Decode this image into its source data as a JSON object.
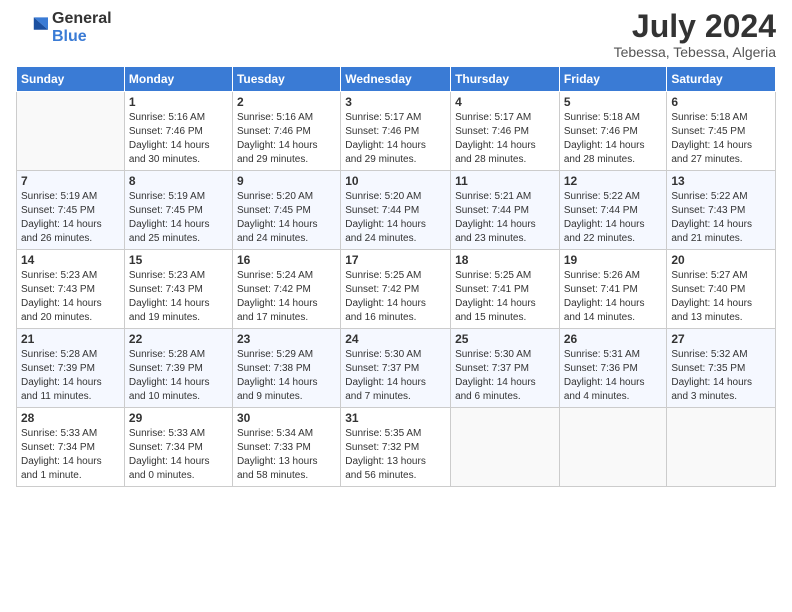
{
  "logo": {
    "general": "General",
    "blue": "Blue"
  },
  "title": {
    "month_year": "July 2024",
    "location": "Tebessa, Tebessa, Algeria"
  },
  "headers": [
    "Sunday",
    "Monday",
    "Tuesday",
    "Wednesday",
    "Thursday",
    "Friday",
    "Saturday"
  ],
  "weeks": [
    [
      {
        "day": "",
        "info": ""
      },
      {
        "day": "1",
        "info": "Sunrise: 5:16 AM\nSunset: 7:46 PM\nDaylight: 14 hours\nand 30 minutes."
      },
      {
        "day": "2",
        "info": "Sunrise: 5:16 AM\nSunset: 7:46 PM\nDaylight: 14 hours\nand 29 minutes."
      },
      {
        "day": "3",
        "info": "Sunrise: 5:17 AM\nSunset: 7:46 PM\nDaylight: 14 hours\nand 29 minutes."
      },
      {
        "day": "4",
        "info": "Sunrise: 5:17 AM\nSunset: 7:46 PM\nDaylight: 14 hours\nand 28 minutes."
      },
      {
        "day": "5",
        "info": "Sunrise: 5:18 AM\nSunset: 7:46 PM\nDaylight: 14 hours\nand 28 minutes."
      },
      {
        "day": "6",
        "info": "Sunrise: 5:18 AM\nSunset: 7:45 PM\nDaylight: 14 hours\nand 27 minutes."
      }
    ],
    [
      {
        "day": "7",
        "info": "Sunrise: 5:19 AM\nSunset: 7:45 PM\nDaylight: 14 hours\nand 26 minutes."
      },
      {
        "day": "8",
        "info": "Sunrise: 5:19 AM\nSunset: 7:45 PM\nDaylight: 14 hours\nand 25 minutes."
      },
      {
        "day": "9",
        "info": "Sunrise: 5:20 AM\nSunset: 7:45 PM\nDaylight: 14 hours\nand 24 minutes."
      },
      {
        "day": "10",
        "info": "Sunrise: 5:20 AM\nSunset: 7:44 PM\nDaylight: 14 hours\nand 24 minutes."
      },
      {
        "day": "11",
        "info": "Sunrise: 5:21 AM\nSunset: 7:44 PM\nDaylight: 14 hours\nand 23 minutes."
      },
      {
        "day": "12",
        "info": "Sunrise: 5:22 AM\nSunset: 7:44 PM\nDaylight: 14 hours\nand 22 minutes."
      },
      {
        "day": "13",
        "info": "Sunrise: 5:22 AM\nSunset: 7:43 PM\nDaylight: 14 hours\nand 21 minutes."
      }
    ],
    [
      {
        "day": "14",
        "info": "Sunrise: 5:23 AM\nSunset: 7:43 PM\nDaylight: 14 hours\nand 20 minutes."
      },
      {
        "day": "15",
        "info": "Sunrise: 5:23 AM\nSunset: 7:43 PM\nDaylight: 14 hours\nand 19 minutes."
      },
      {
        "day": "16",
        "info": "Sunrise: 5:24 AM\nSunset: 7:42 PM\nDaylight: 14 hours\nand 17 minutes."
      },
      {
        "day": "17",
        "info": "Sunrise: 5:25 AM\nSunset: 7:42 PM\nDaylight: 14 hours\nand 16 minutes."
      },
      {
        "day": "18",
        "info": "Sunrise: 5:25 AM\nSunset: 7:41 PM\nDaylight: 14 hours\nand 15 minutes."
      },
      {
        "day": "19",
        "info": "Sunrise: 5:26 AM\nSunset: 7:41 PM\nDaylight: 14 hours\nand 14 minutes."
      },
      {
        "day": "20",
        "info": "Sunrise: 5:27 AM\nSunset: 7:40 PM\nDaylight: 14 hours\nand 13 minutes."
      }
    ],
    [
      {
        "day": "21",
        "info": "Sunrise: 5:28 AM\nSunset: 7:39 PM\nDaylight: 14 hours\nand 11 minutes."
      },
      {
        "day": "22",
        "info": "Sunrise: 5:28 AM\nSunset: 7:39 PM\nDaylight: 14 hours\nand 10 minutes."
      },
      {
        "day": "23",
        "info": "Sunrise: 5:29 AM\nSunset: 7:38 PM\nDaylight: 14 hours\nand 9 minutes."
      },
      {
        "day": "24",
        "info": "Sunrise: 5:30 AM\nSunset: 7:37 PM\nDaylight: 14 hours\nand 7 minutes."
      },
      {
        "day": "25",
        "info": "Sunrise: 5:30 AM\nSunset: 7:37 PM\nDaylight: 14 hours\nand 6 minutes."
      },
      {
        "day": "26",
        "info": "Sunrise: 5:31 AM\nSunset: 7:36 PM\nDaylight: 14 hours\nand 4 minutes."
      },
      {
        "day": "27",
        "info": "Sunrise: 5:32 AM\nSunset: 7:35 PM\nDaylight: 14 hours\nand 3 minutes."
      }
    ],
    [
      {
        "day": "28",
        "info": "Sunrise: 5:33 AM\nSunset: 7:34 PM\nDaylight: 14 hours\nand 1 minute."
      },
      {
        "day": "29",
        "info": "Sunrise: 5:33 AM\nSunset: 7:34 PM\nDaylight: 14 hours\nand 0 minutes."
      },
      {
        "day": "30",
        "info": "Sunrise: 5:34 AM\nSunset: 7:33 PM\nDaylight: 13 hours\nand 58 minutes."
      },
      {
        "day": "31",
        "info": "Sunrise: 5:35 AM\nSunset: 7:32 PM\nDaylight: 13 hours\nand 56 minutes."
      },
      {
        "day": "",
        "info": ""
      },
      {
        "day": "",
        "info": ""
      },
      {
        "day": "",
        "info": ""
      }
    ]
  ]
}
